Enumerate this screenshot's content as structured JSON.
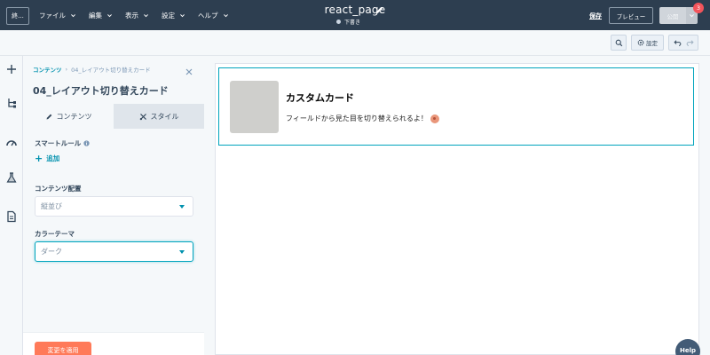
{
  "topbar": {
    "exit_label": "終...",
    "menus": [
      {
        "label": "ファイル"
      },
      {
        "label": "編集"
      },
      {
        "label": "表示"
      },
      {
        "label": "設定"
      },
      {
        "label": "ヘルプ"
      }
    ],
    "page_title": "react_page",
    "status": "下書き",
    "save_label": "保存",
    "preview_label": "プレビュー",
    "publish_label": "公開",
    "notification_count": "3"
  },
  "toolbar": {
    "settings_label": "設定"
  },
  "panel": {
    "breadcrumb_root": "コンテンツ",
    "breadcrumb_current": "04_レイアウト切り替えカード",
    "module_title": "04_レイアウト切り替えカード",
    "tabs": [
      {
        "label": "コンテンツ"
      },
      {
        "label": "スタイル"
      }
    ],
    "smart_rule_label": "スマートルール",
    "add_label": "追加",
    "layout_label": "コンテンツ配置",
    "layout_value": "縦並び",
    "theme_label": "カラーテーマ",
    "theme_value": "ダーク",
    "apply_label": "変更を適用"
  },
  "card": {
    "title": "カスタムカード",
    "text": "フィールドから見た目を切り替えられるよ！"
  },
  "help": {
    "label": "Help"
  },
  "colors": {
    "topbar": "#2d3e50",
    "accent": "#00a4bd",
    "link": "#0091ae",
    "primary_button": "#ff7a59",
    "badge": "#f2545b"
  }
}
